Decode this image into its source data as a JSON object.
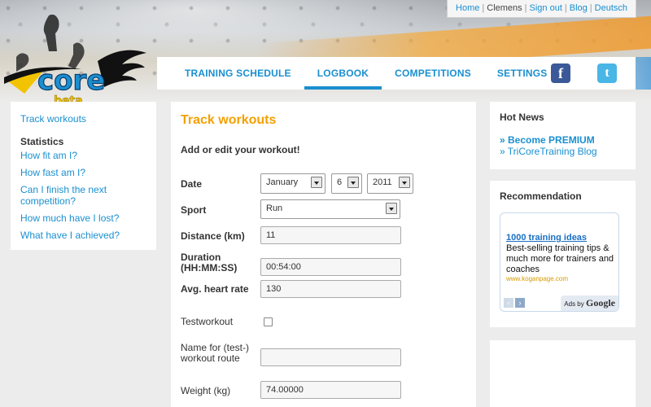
{
  "top_links": {
    "home": "Home",
    "user": "Clemens",
    "sign_out": "Sign out",
    "blog": "Blog",
    "language": "Deutsch"
  },
  "logo": {
    "name": "core",
    "tag": "beta"
  },
  "nav": {
    "items": [
      {
        "label": "TRAINING SCHEDULE",
        "active": false
      },
      {
        "label": "LOGBOOK",
        "active": true
      },
      {
        "label": "COMPETITIONS",
        "active": false
      },
      {
        "label": "SETTINGS",
        "active": false
      }
    ],
    "facebook_icon": "facebook-icon",
    "twitter_icon": "twitter-icon"
  },
  "sidebar": {
    "track_workouts": "Track workouts",
    "statistics_heading": "Statistics",
    "items": [
      "How fit am I?",
      "How fast am I?",
      "Can I finish the next competition?",
      "How much have I lost?",
      "What have I achieved?"
    ]
  },
  "main": {
    "title": "Track workouts",
    "subtitle": "Add or edit your workout!",
    "date_label": "Date",
    "date_month": "January",
    "date_day": "6",
    "date_year": "2011",
    "sport_label": "Sport",
    "sport_value": "Run",
    "distance_label": "Distance (km)",
    "distance_value": "11",
    "duration_label_1": "Duration",
    "duration_label_2": "(HH:MM:SS)",
    "duration_value": "00:54:00",
    "heart_rate_label": "Avg. heart rate",
    "heart_rate_value": "130",
    "testworkout_label": "Testworkout",
    "testworkout_checked": false,
    "route_label_1": "Name for (test-)",
    "route_label_2": "workout route",
    "route_value": "",
    "weight_label": "Weight (kg)",
    "weight_value": "74.00000"
  },
  "right": {
    "hot_news_title": "Hot News",
    "hot_news_items": [
      "» Become PREMIUM",
      "» TriCoreTraining Blog"
    ],
    "recommendation_title": "Recommendation",
    "ad": {
      "title": "1000 training ideas",
      "text": "Best-selling training tips & much more for trainers and coaches",
      "url": "www.koganpage.com",
      "ads_by": "Ads by",
      "google": "Google"
    }
  },
  "colors": {
    "link_blue": "#1a8fd0",
    "title_orange": "#f5a000",
    "page_bg": "#ececec"
  }
}
